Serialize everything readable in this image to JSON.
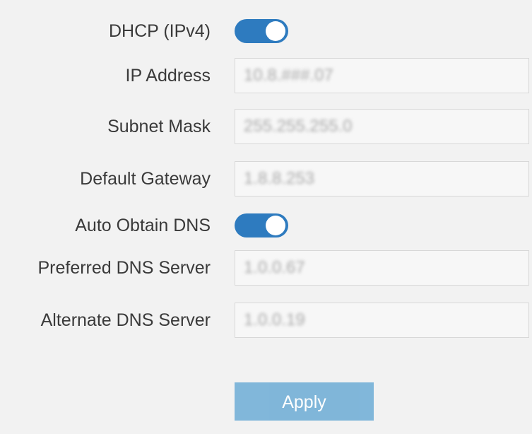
{
  "network_settings": {
    "dhcp": {
      "label": "DHCP (IPv4)",
      "enabled": true
    },
    "ip_address": {
      "label": "IP Address",
      "value": "10.8.###.07"
    },
    "subnet_mask": {
      "label": "Subnet Mask",
      "value": "255.255.255.0"
    },
    "default_gateway": {
      "label": "Default Gateway",
      "value": "1.8.8.253"
    },
    "auto_obtain_dns": {
      "label": "Auto Obtain DNS",
      "enabled": true
    },
    "preferred_dns": {
      "label": "Preferred DNS Server",
      "value": "1.0.0.67"
    },
    "alternate_dns": {
      "label": "Alternate DNS Server",
      "value": "1.0.0.19"
    },
    "apply_label": "Apply"
  },
  "colors": {
    "toggle_on": "#2e7bbf",
    "apply_button": "#7ab3d8",
    "label_text": "#3a3a3a"
  }
}
